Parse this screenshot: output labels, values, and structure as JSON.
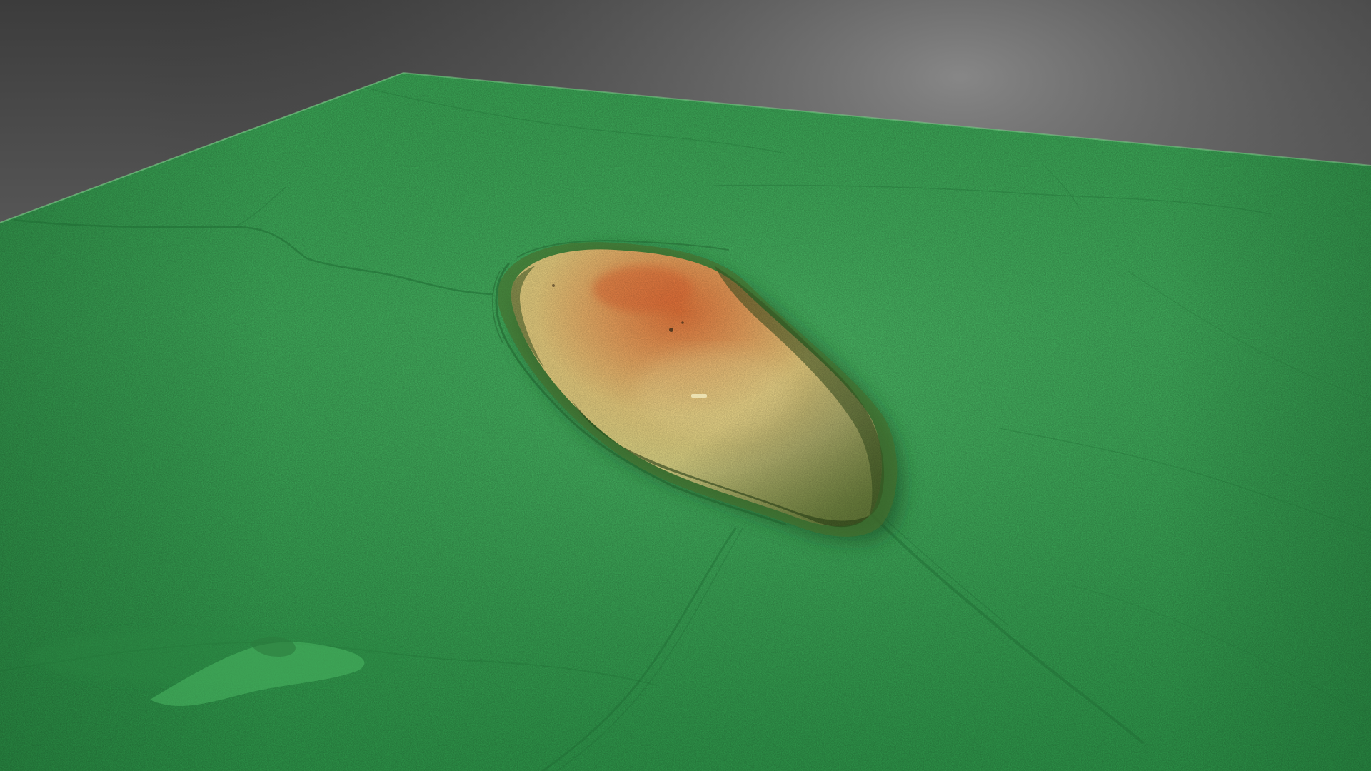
{
  "scene": {
    "subject": "terrain-elevation-model",
    "colors": {
      "background_top": "#3e3e3e",
      "background_bottom": "#8a8a8a",
      "ground": "#3fae5c",
      "ground_light": "#52c06b",
      "ground_dark": "#2f8e47",
      "hill_low": "#c9c46a",
      "hill_mid": "#e0d27c",
      "hill_high": "#e8965a",
      "hill_peak": "#e07a3e",
      "shadow": "#2e4a22"
    }
  }
}
